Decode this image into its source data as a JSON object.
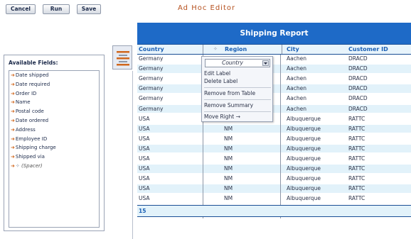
{
  "toolbar": {
    "cancel_label": "Cancel",
    "run_label": "Run",
    "save_label": "Save"
  },
  "title": "Ad Hoc Editor",
  "available_fields": {
    "heading": "Available Fields:",
    "items": [
      {
        "label": "Date shipped"
      },
      {
        "label": "Date required"
      },
      {
        "label": "Order ID"
      },
      {
        "label": "Name"
      },
      {
        "label": "Postal code"
      },
      {
        "label": "Date ordered"
      },
      {
        "label": "Address"
      },
      {
        "label": "Employee ID"
      },
      {
        "label": "Shipping charge"
      },
      {
        "label": "Shipped via"
      }
    ],
    "spacer": {
      "mark": "✧",
      "label": "(Spacer)"
    }
  },
  "report": {
    "title": "Shipping Report",
    "columns": [
      "Country",
      "Region",
      "City",
      "Customer ID"
    ],
    "sort_mark": "✧",
    "rows": [
      [
        "Germany",
        "",
        "Aachen",
        "DRACD"
      ],
      [
        "Germany",
        "",
        "Aachen",
        "DRACD"
      ],
      [
        "Germany",
        "",
        "Aachen",
        "DRACD"
      ],
      [
        "Germany",
        "",
        "Aachen",
        "DRACD"
      ],
      [
        "Germany",
        "",
        "Aachen",
        "DRACD"
      ],
      [
        "Germany",
        "",
        "Aachen",
        "DRACD"
      ],
      [
        "USA",
        "NM",
        "Albuquerque",
        "RATTC"
      ],
      [
        "USA",
        "NM",
        "Albuquerque",
        "RATTC"
      ],
      [
        "USA",
        "NM",
        "Albuquerque",
        "RATTC"
      ],
      [
        "USA",
        "NM",
        "Albuquerque",
        "RATTC"
      ],
      [
        "USA",
        "NM",
        "Albuquerque",
        "RATTC"
      ],
      [
        "USA",
        "NM",
        "Albuquerque",
        "RATTC"
      ],
      [
        "USA",
        "NM",
        "Albuquerque",
        "RATTC"
      ],
      [
        "USA",
        "NM",
        "Albuquerque",
        "RATTC"
      ],
      [
        "USA",
        "NM",
        "Albuquerque",
        "RATTC"
      ]
    ],
    "summary_count": "15"
  },
  "context_menu": {
    "selected_field": "Country",
    "items": {
      "edit_label": "Edit Label",
      "delete_label": "Delete Label",
      "remove_from_table": "Remove from Table",
      "remove_summary": "Remove Summary",
      "move_right": "Move Right →"
    }
  },
  "colors": {
    "accent": "#1e6ac7",
    "title": "#b5501e",
    "field_arrow": "#d0671e",
    "row_alt": "#e2f2fa"
  }
}
